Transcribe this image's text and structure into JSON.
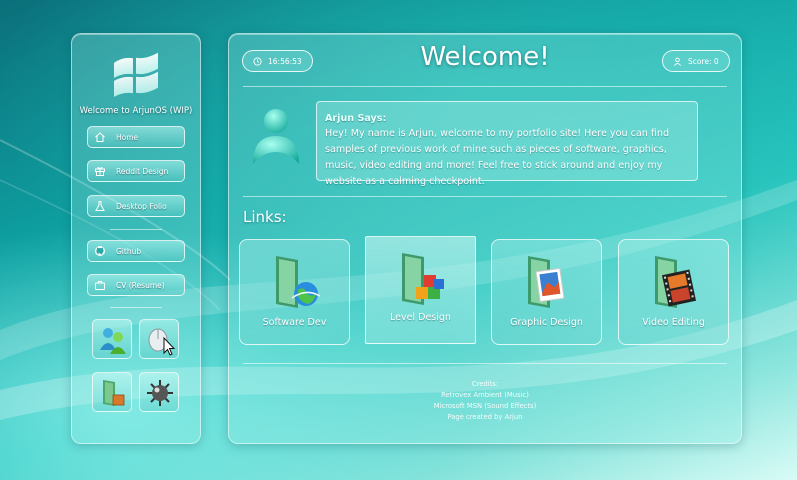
{
  "sidebar": {
    "title": "Welcome to ArjunOS (WIP)",
    "nav": [
      {
        "label": "Home",
        "icon": "home-icon"
      },
      {
        "label": "Reddit Design",
        "icon": "gift-icon"
      },
      {
        "label": "Desktop Folio",
        "icon": "flask-icon"
      }
    ],
    "external": [
      {
        "label": "Github",
        "icon": "github-icon"
      },
      {
        "label": "CV (Resume)",
        "icon": "briefcase-icon"
      }
    ],
    "apps": [
      "msn-buddies-icon",
      "mouse-pointer-icon",
      "book-folder-icon",
      "minesweeper-icon"
    ]
  },
  "header": {
    "time": "16:56:53",
    "title": "Welcome!",
    "score_label": "Score: 0"
  },
  "intro": {
    "speaker": "Arjun Says:",
    "text": "Hey! My name is Arjun, welcome to my portfolio site! Here you can find samples of previous work of mine such as pieces of software, graphics, music, video editing and more! Feel free to stick around and enjoy my website as a calming checkpoint."
  },
  "links": {
    "title": "Links:",
    "items": [
      {
        "label": "Software Dev",
        "icon": "globe-folder-icon"
      },
      {
        "label": "Level Design",
        "icon": "blocks-folder-icon"
      },
      {
        "label": "Graphic Design",
        "icon": "photo-folder-icon"
      },
      {
        "label": "Video Editing",
        "icon": "film-folder-icon"
      }
    ]
  },
  "credits": {
    "heading": "Credits:",
    "lines": [
      "Retrovex Ambient (Music)",
      "Microsoft MSN (Sound Effects)",
      "Page created by Arjun"
    ]
  },
  "colors": {
    "accent": "#2fc7bf",
    "glass": "#a0f0e8"
  }
}
